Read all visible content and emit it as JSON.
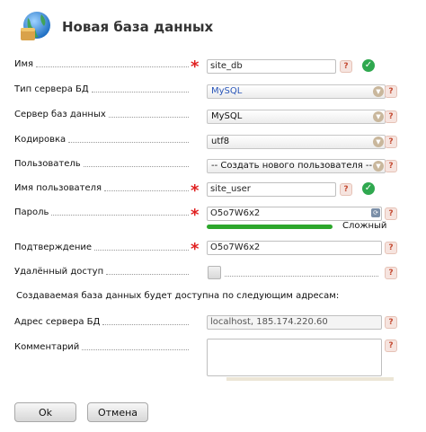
{
  "header": {
    "title": "Новая база данных",
    "icon": "globe-database-icon"
  },
  "fields": {
    "name": {
      "label": "Имя",
      "value": "site_db"
    },
    "server_type": {
      "label": "Тип сервера БД",
      "value": "MySQL"
    },
    "db_server": {
      "label": "Сервер баз данных",
      "value": "MySQL"
    },
    "encoding": {
      "label": "Кодировка",
      "value": "utf8"
    },
    "user": {
      "label": "Пользователь",
      "value": "-- Создать нового пользователя --"
    },
    "username": {
      "label": "Имя пользователя",
      "value": "site_user"
    },
    "password": {
      "label": "Пароль",
      "value": "O5o7W6x2",
      "strength_label": "Сложный",
      "strength_fraction": 0.9
    },
    "confirm": {
      "label": "Подтверждение",
      "value": "O5o7W6x2"
    },
    "remote": {
      "label": "Удалённый доступ",
      "checked": false
    },
    "info_text": "Создаваемая база данных будет доступна по следующим адресам:",
    "server_address": {
      "label": "Адрес сервера БД",
      "value": "localhost, 185.174.220.60"
    },
    "comment": {
      "label": "Комментарий",
      "value": ""
    }
  },
  "symbols": {
    "required": "*",
    "help": "?",
    "check": "✓",
    "caret": "▼",
    "gen": "⟳"
  },
  "buttons": {
    "ok": "Ok",
    "cancel": "Отмена"
  },
  "colors": {
    "required": "#e02020",
    "ok": "#2fa84f",
    "strength": "#2da72c",
    "link_blue": "#2a56b8"
  }
}
